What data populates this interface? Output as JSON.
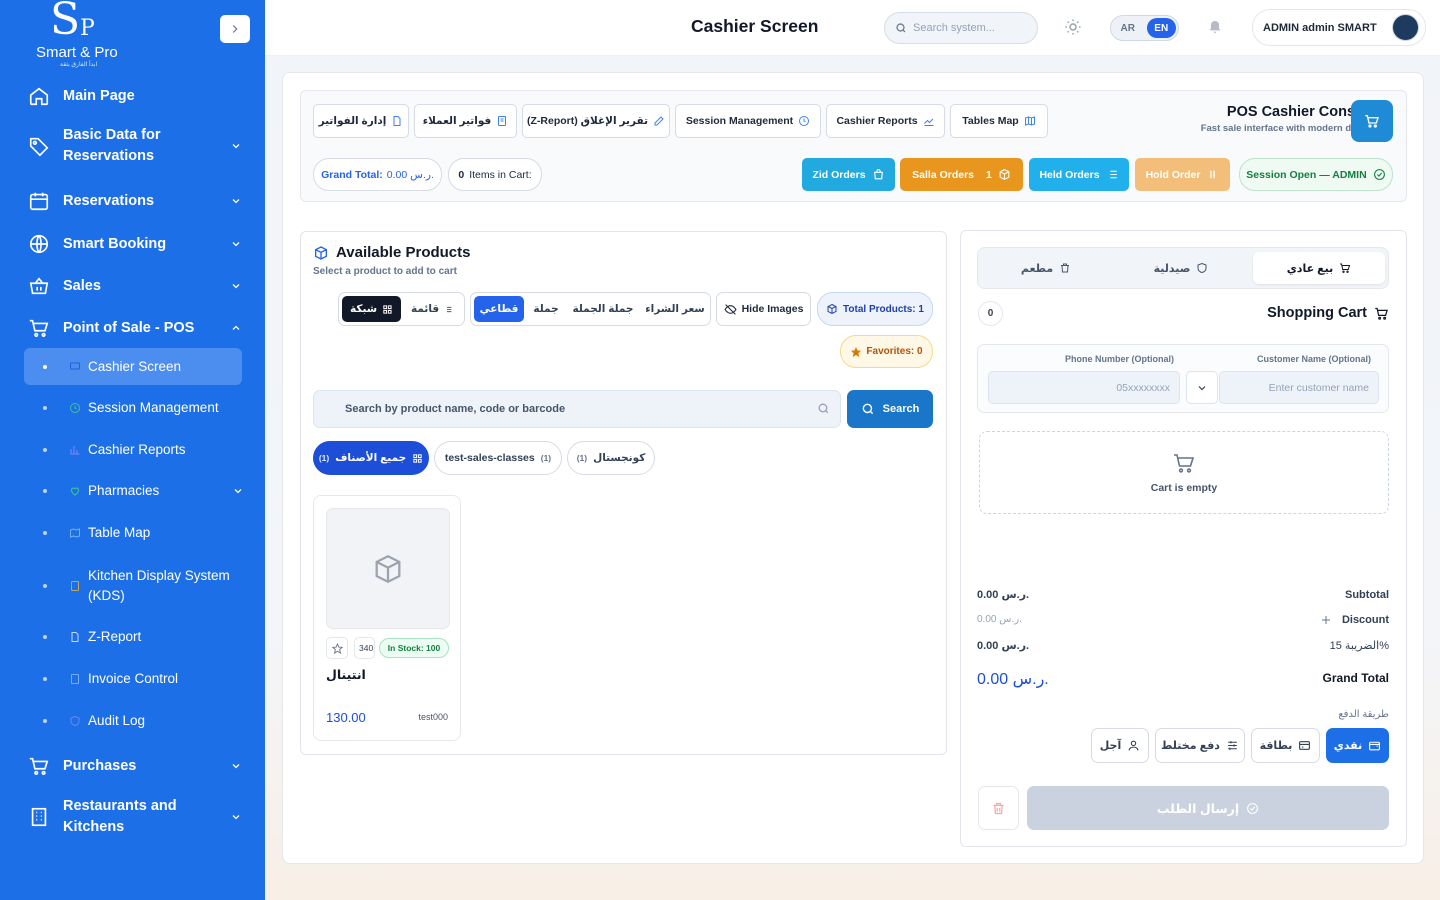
{
  "sidebar": {
    "brand": "Smart & Pro",
    "tagline": "ابدأ الفارق بثقة",
    "items": [
      {
        "label": "Main Page"
      },
      {
        "label": "Basic Data for Reservations"
      },
      {
        "label": "Reservations"
      },
      {
        "label": "Smart Booking"
      },
      {
        "label": "Sales"
      },
      {
        "label": "Point of Sale - POS"
      },
      {
        "label": "Purchases"
      },
      {
        "label": "Restaurants and Kitchens"
      }
    ],
    "pos_sub": [
      {
        "label": "Cashier Screen",
        "active": true
      },
      {
        "label": "Session Management"
      },
      {
        "label": "Cashier Reports"
      },
      {
        "label": "Pharmacies"
      },
      {
        "label": "Table Map"
      },
      {
        "label": "Kitchen Display System (KDS)"
      },
      {
        "label": "Z-Report"
      },
      {
        "label": "Invoice Control"
      },
      {
        "label": "Audit Log"
      }
    ]
  },
  "topbar": {
    "title": "Cashier Screen",
    "search_placeholder": "Search system...",
    "lang_ar": "AR",
    "lang_en": "EN",
    "user": "ADMIN admin SMART"
  },
  "console": {
    "title": "POS Cashier Console",
    "subtitle": "Fast sale interface with modern design",
    "top_buttons": [
      "إدارة الفواتير",
      "فواتير العملاء",
      "(Z-Report) تقرير الإغلاق",
      "Session Management",
      "Cashier Reports",
      "Tables Map"
    ],
    "grand_total_label": "Grand Total:",
    "grand_total_value": "0.00 ر.س.",
    "items_label": "Items in Cart:",
    "items_value": "0",
    "zid_orders": "Zid Orders",
    "salla_orders": "Salla Orders",
    "salla_count": "1",
    "held_orders": "Held Orders",
    "hold_order": "Hold Order",
    "session": "Session Open — ADMIN"
  },
  "products": {
    "title": "Available Products",
    "subtitle": "Select a product to add to cart",
    "view_grid": "شبكة",
    "view_list": "قائمة",
    "price_retail": "قطاعي",
    "price_wholesale": "جملة",
    "price_bulk": "جملة الجملة",
    "price_purchase": "سعر الشراء",
    "hide_images": "Hide Images",
    "total_products": "Total Products: 1",
    "favorites": "Favorites: 0",
    "search_placeholder": "Search by product name, code or barcode",
    "search_button": "Search",
    "categories": [
      {
        "label": "جميع الأصناف",
        "count": "(1)",
        "active": true
      },
      {
        "label": "test-sales-classes",
        "count": "(1)"
      },
      {
        "label": "كونجستال",
        "count": "(1)"
      }
    ],
    "items": [
      {
        "name": "انتينال",
        "price": "130.00",
        "code": "test000",
        "stock": "In Stock: 100",
        "qty": "340"
      }
    ]
  },
  "cart": {
    "tabs": [
      "بيع عادي",
      "صيدلية",
      "مطعم"
    ],
    "title": "Shopping Cart",
    "count": "0",
    "phone_label": "Phone Number (Optional)",
    "phone_placeholder": "05xxxxxxxx",
    "customer_label": "Customer Name (Optional)",
    "customer_placeholder": "Enter customer name",
    "empty": "Cart is empty",
    "subtotal_label": "Subtotal",
    "subtotal_value": "0.00 ر.س.",
    "discount_label": "Discount",
    "discount_value": "0.00 ر.س.",
    "tax_label": "الضريبة 15%",
    "tax_value": "0.00 ر.س.",
    "grand_total_label": "Grand Total",
    "grand_total_value": "0.00 ر.س.",
    "payment_label": "طريقة الدفع",
    "payments": [
      "نقدي",
      "بطاقة",
      "دفع مختلط",
      "آجل"
    ],
    "submit": "إرسال الطلب"
  },
  "colors": {
    "primary": "#1d6fe8",
    "accent": "#1f8ad6",
    "zid": "#22a9e0",
    "salla": "#e8961e",
    "held": "#22b0ec",
    "hold": "#f2be7a",
    "success": "#15803d"
  }
}
